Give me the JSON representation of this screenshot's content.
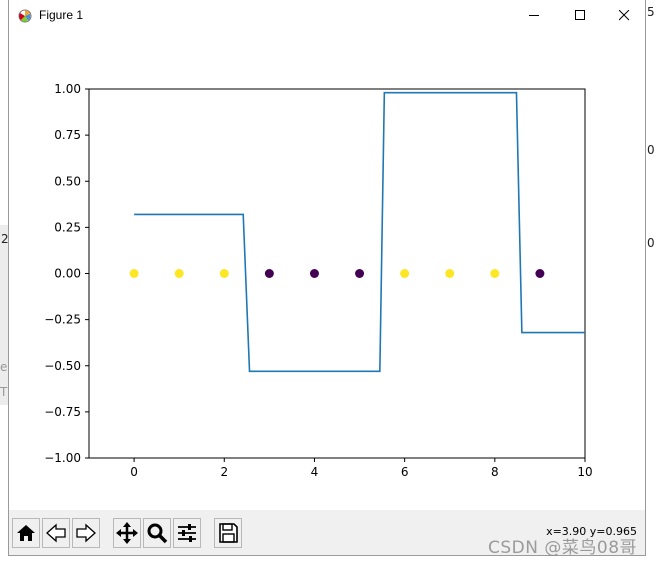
{
  "window": {
    "title": "Figure 1",
    "controls": {
      "minimize": "minimize-icon",
      "maximize": "maximize-icon",
      "close": "close-icon"
    }
  },
  "toolbar": {
    "buttons": [
      "home-icon",
      "back-icon",
      "forward-icon",
      "pan-icon",
      "zoom-icon",
      "configure-subplots-icon",
      "save-icon"
    ],
    "coords_readout": "x=3.90 y=0.965"
  },
  "background": {
    "left_fragments": [
      "2",
      "e",
      "T"
    ],
    "right_fragments": [
      "5",
      "0",
      "0"
    ]
  },
  "watermark": "CSDN @菜鸟08哥",
  "colors": {
    "line": "#1f77b4",
    "point_yellow": "#fde725",
    "point_purple": "#440154"
  },
  "chart_data": {
    "type": "line",
    "xlim": [
      -1,
      10
    ],
    "ylim": [
      -1.0,
      1.0
    ],
    "x_ticks": [
      "0",
      "2",
      "4",
      "6",
      "8",
      "10"
    ],
    "y_ticks": [
      "1.00",
      "0.75",
      "0.50",
      "0.25",
      "0.00",
      "−0.25",
      "−0.50",
      "−0.75",
      "−1.00"
    ],
    "grid": false,
    "series": [
      {
        "kind": "step-line",
        "x": [
          0,
          2.42,
          2.56,
          5.45,
          5.55,
          8.48,
          8.6,
          10
        ],
        "y": [
          0.32,
          0.32,
          -0.53,
          -0.53,
          0.98,
          0.98,
          -0.32,
          -0.32
        ]
      },
      {
        "kind": "scatter",
        "x": [
          0,
          1,
          2,
          3,
          4,
          5,
          6,
          7,
          8,
          9
        ],
        "y": [
          0,
          0,
          0,
          0,
          0,
          0,
          0,
          0,
          0,
          0
        ],
        "color_class": [
          "yellow",
          "yellow",
          "yellow",
          "purple",
          "purple",
          "purple",
          "yellow",
          "yellow",
          "yellow",
          "purple"
        ]
      }
    ]
  }
}
